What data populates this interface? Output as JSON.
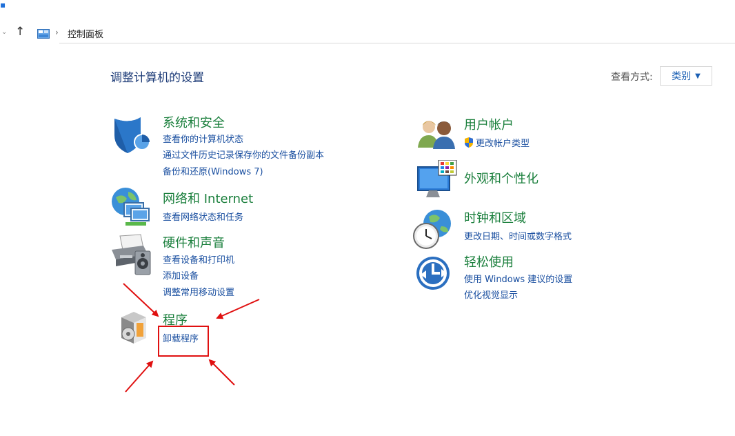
{
  "address_bar": {
    "path_label": "控制面板"
  },
  "header": {
    "title": "调整计算机的设置",
    "view_label": "查看方式:",
    "view_value": "类别"
  },
  "categories": {
    "system": {
      "title": "系统和安全",
      "links": [
        "查看你的计算机状态",
        "通过文件历史记录保存你的文件备份副本",
        "备份和还原(Windows 7)"
      ]
    },
    "network": {
      "title": "网络和 Internet",
      "links": [
        "查看网络状态和任务"
      ]
    },
    "hardware": {
      "title": "硬件和声音",
      "links": [
        "查看设备和打印机",
        "添加设备",
        "调整常用移动设置"
      ]
    },
    "programs": {
      "title": "程序",
      "links": [
        "卸载程序"
      ]
    },
    "users": {
      "title": "用户帐户",
      "links": [
        "更改帐户类型"
      ]
    },
    "appearance": {
      "title": "外观和个性化",
      "links": []
    },
    "clock": {
      "title": "时钟和区域",
      "links": [
        "更改日期、时间或数字格式"
      ]
    },
    "ease": {
      "title": "轻松使用",
      "links": [
        "使用 Windows 建议的设置",
        "优化视觉显示"
      ]
    }
  },
  "colors": {
    "category_title": "#1a7f3c",
    "link": "#1a4fa0",
    "annotation": "#e01010"
  }
}
